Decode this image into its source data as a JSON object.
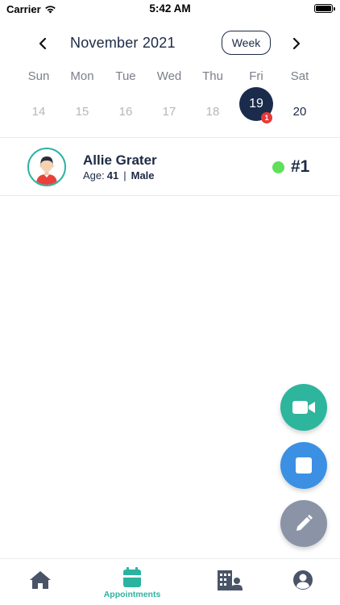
{
  "status_bar": {
    "carrier": "Carrier",
    "time": "5:42 AM"
  },
  "calendar": {
    "month_title": "November 2021",
    "view_toggle_label": "Week",
    "days": [
      {
        "name": "Sun",
        "num": "14"
      },
      {
        "name": "Mon",
        "num": "15"
      },
      {
        "name": "Tue",
        "num": "16"
      },
      {
        "name": "Wed",
        "num": "17"
      },
      {
        "name": "Thu",
        "num": "18"
      },
      {
        "name": "Fri",
        "num": "19",
        "badge": "1"
      },
      {
        "name": "Sat",
        "num": "20"
      }
    ],
    "selected_day": "19"
  },
  "patient": {
    "name": "Allie Grater",
    "age_label": "Age:",
    "age": "41",
    "separator": "|",
    "gender": "Male",
    "queue_number": "#1",
    "status_color": "#5ee05a"
  },
  "fabs": {
    "video_icon": "video-camera-icon",
    "stop_icon": "stop-square-icon",
    "edit_icon": "pencil-icon"
  },
  "tab_bar": {
    "home_icon": "home-icon",
    "appointments_label": "Appointments",
    "appointments_icon": "calendar-icon",
    "hospital_icon": "hospital-staff-icon",
    "profile_icon": "user-circle-icon"
  },
  "colors": {
    "accent_teal": "#2bb3a1",
    "navy": "#1a2b4c",
    "video_fab": "#2db59d",
    "stop_fab": "#3b90e3",
    "edit_fab": "#8a94a6",
    "badge_red": "#e53935"
  }
}
